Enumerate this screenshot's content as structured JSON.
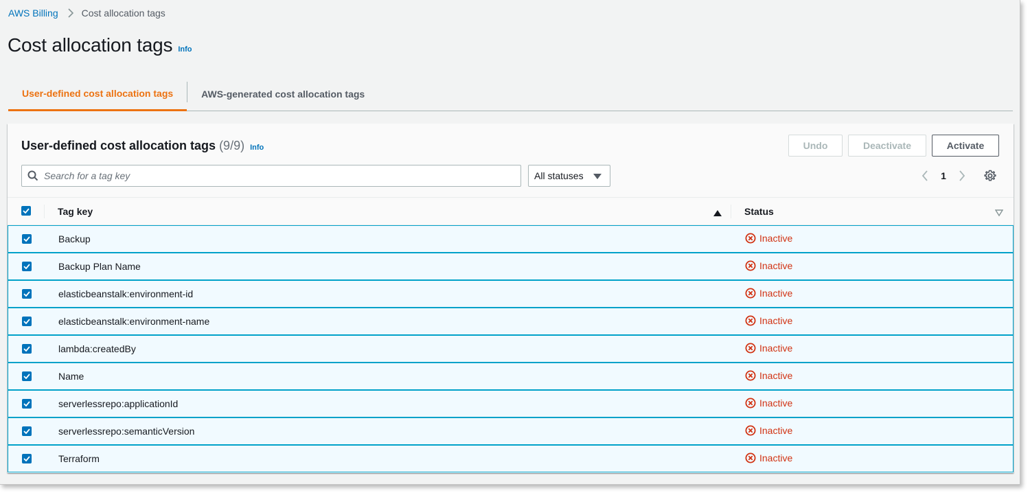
{
  "breadcrumb": {
    "root": "AWS Billing",
    "current": "Cost allocation tags"
  },
  "page": {
    "title": "Cost allocation tags",
    "info": "Info"
  },
  "tabs": [
    {
      "label": "User-defined cost allocation tags",
      "active": true
    },
    {
      "label": "AWS-generated cost allocation tags",
      "active": false
    }
  ],
  "panel": {
    "title": "User-defined cost allocation tags",
    "count": "(9/9)",
    "info": "Info",
    "buttons": {
      "undo": "Undo",
      "deactivate": "Deactivate",
      "activate": "Activate"
    },
    "search": {
      "placeholder": "Search for a tag key"
    },
    "status_filter": {
      "selected": "All statuses"
    },
    "pagination": {
      "current_page": "1"
    }
  },
  "table": {
    "columns": {
      "tag_key": "Tag key",
      "status": "Status"
    },
    "rows": [
      {
        "key": "Backup",
        "status": "Inactive",
        "selected": true
      },
      {
        "key": "Backup Plan Name",
        "status": "Inactive",
        "selected": true
      },
      {
        "key": "elasticbeanstalk:environment-id",
        "status": "Inactive",
        "selected": true
      },
      {
        "key": "elasticbeanstalk:environment-name",
        "status": "Inactive",
        "selected": true
      },
      {
        "key": "lambda:createdBy",
        "status": "Inactive",
        "selected": true
      },
      {
        "key": "Name",
        "status": "Inactive",
        "selected": true
      },
      {
        "key": "serverlessrepo:applicationId",
        "status": "Inactive",
        "selected": true
      },
      {
        "key": "serverlessrepo:semanticVersion",
        "status": "Inactive",
        "selected": true
      },
      {
        "key": "Terraform",
        "status": "Inactive",
        "selected": true
      }
    ]
  },
  "colors": {
    "link": "#0073bb",
    "active_tab": "#ec7211",
    "inactive_status": "#d13212",
    "selected_row_bg": "#f1faff",
    "selected_row_border": "#00a1c9"
  },
  "icons": {
    "breadcrumb_separator": "chevron-right-icon",
    "search": "search-icon",
    "select": "caret-down-icon",
    "pager_prev": "chevron-left-icon",
    "pager_next": "chevron-right-icon",
    "settings": "gear-icon",
    "sort_asc": "sort-ascending-icon",
    "sort_none": "sort-descending-icon",
    "status": "x-circle-icon",
    "checkbox": "checkmark-icon"
  }
}
